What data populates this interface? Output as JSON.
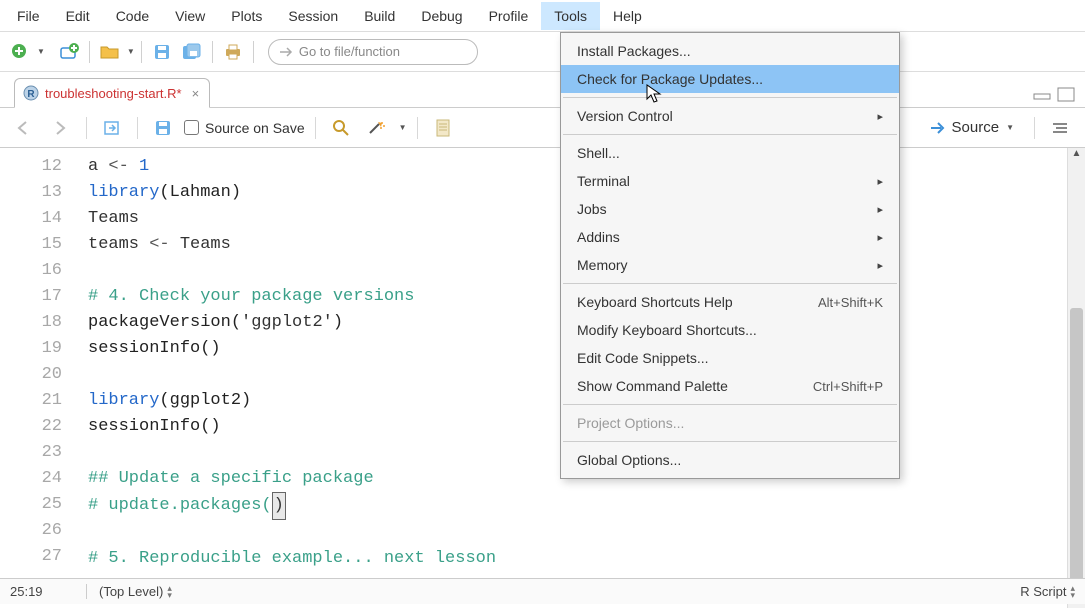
{
  "menubar": [
    "File",
    "Edit",
    "Code",
    "View",
    "Plots",
    "Session",
    "Build",
    "Debug",
    "Profile",
    "Tools",
    "Help"
  ],
  "menubar_active_index": 9,
  "goto_placeholder": "Go to file/function",
  "tab": {
    "filename": "troubleshooting-start.R*"
  },
  "editor_toolbar": {
    "source_on_save_label": "Source on Save",
    "source_label": "Source"
  },
  "gutter_start": 12,
  "gutter_end": 27,
  "code_lines": [
    {
      "n": 12,
      "seg": [
        {
          "t": "a",
          "c": ""
        },
        {
          "t": " <- ",
          "c": "op"
        },
        {
          "t": "1",
          "c": "num"
        }
      ]
    },
    {
      "n": 13,
      "seg": [
        {
          "t": "library",
          "c": "kw"
        },
        {
          "t": "(Lahman)",
          "c": "paren"
        }
      ]
    },
    {
      "n": 14,
      "seg": [
        {
          "t": "Teams",
          "c": ""
        }
      ]
    },
    {
      "n": 15,
      "seg": [
        {
          "t": "teams",
          "c": ""
        },
        {
          "t": " <- ",
          "c": "op"
        },
        {
          "t": "Teams",
          "c": ""
        }
      ]
    },
    {
      "n": 16,
      "seg": []
    },
    {
      "n": 17,
      "seg": [
        {
          "t": "# 4. Check your package versions",
          "c": "cmt"
        }
      ]
    },
    {
      "n": 18,
      "seg": [
        {
          "t": "packageVersion",
          "c": "fn"
        },
        {
          "t": "(",
          "c": "paren"
        },
        {
          "t": "'ggplot2'",
          "c": "str"
        },
        {
          "t": ")",
          "c": "paren"
        }
      ]
    },
    {
      "n": 19,
      "seg": [
        {
          "t": "sessionInfo",
          "c": "fn"
        },
        {
          "t": "()",
          "c": "paren"
        }
      ]
    },
    {
      "n": 20,
      "seg": []
    },
    {
      "n": 21,
      "seg": [
        {
          "t": "library",
          "c": "kw"
        },
        {
          "t": "(ggplot2)",
          "c": "paren"
        }
      ]
    },
    {
      "n": 22,
      "seg": [
        {
          "t": "sessionInfo",
          "c": "fn"
        },
        {
          "t": "()",
          "c": "paren"
        }
      ]
    },
    {
      "n": 23,
      "seg": []
    },
    {
      "n": 24,
      "seg": [
        {
          "t": "## Update a specific package",
          "c": "cmt"
        }
      ]
    },
    {
      "n": 25,
      "seg": [
        {
          "t": "# update.packages(",
          "c": "cmt"
        },
        {
          "t": ")",
          "c": "cursor"
        }
      ]
    },
    {
      "n": 26,
      "seg": []
    },
    {
      "n": 27,
      "seg": [
        {
          "t": "# 5. Reproducible example... next lesson",
          "c": "cmt"
        }
      ]
    }
  ],
  "statusbar": {
    "pos": "25:19",
    "scope": "(Top Level)",
    "lang": "R Script"
  },
  "dropdown": [
    {
      "type": "item",
      "label": "Install Packages..."
    },
    {
      "type": "item",
      "label": "Check for Package Updates...",
      "hover": true
    },
    {
      "type": "sep"
    },
    {
      "type": "item",
      "label": "Version Control",
      "submenu": true
    },
    {
      "type": "sep"
    },
    {
      "type": "item",
      "label": "Shell..."
    },
    {
      "type": "item",
      "label": "Terminal",
      "submenu": true
    },
    {
      "type": "item",
      "label": "Jobs",
      "submenu": true
    },
    {
      "type": "item",
      "label": "Addins",
      "submenu": true
    },
    {
      "type": "item",
      "label": "Memory",
      "submenu": true
    },
    {
      "type": "sep"
    },
    {
      "type": "item",
      "label": "Keyboard Shortcuts Help",
      "shortcut": "Alt+Shift+K"
    },
    {
      "type": "item",
      "label": "Modify Keyboard Shortcuts..."
    },
    {
      "type": "item",
      "label": "Edit Code Snippets..."
    },
    {
      "type": "item",
      "label": "Show Command Palette",
      "shortcut": "Ctrl+Shift+P"
    },
    {
      "type": "sep"
    },
    {
      "type": "item",
      "label": "Project Options...",
      "disabled": true
    },
    {
      "type": "sep"
    },
    {
      "type": "item",
      "label": "Global Options..."
    }
  ]
}
